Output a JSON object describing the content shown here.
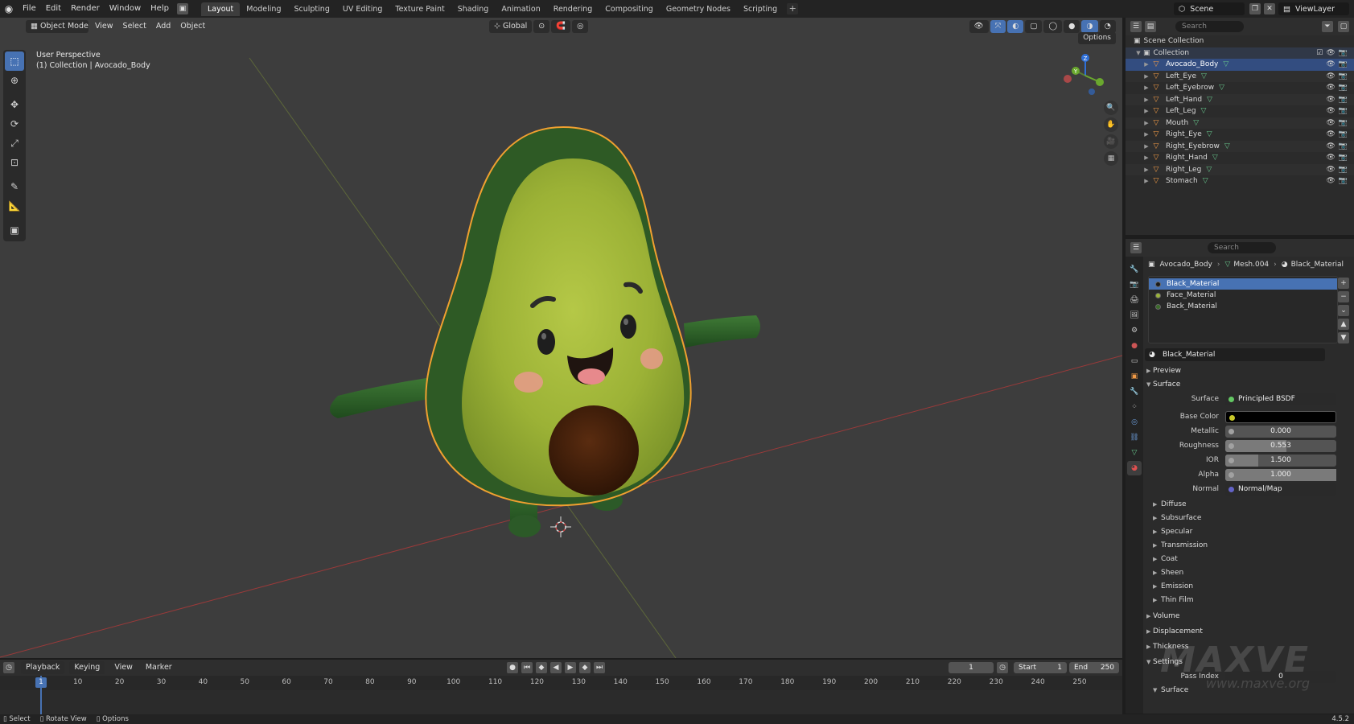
{
  "topbar": {
    "menus": [
      "File",
      "Edit",
      "Render",
      "Window",
      "Help"
    ],
    "workspaces": [
      "Layout",
      "Modeling",
      "Sculpting",
      "UV Editing",
      "Texture Paint",
      "Shading",
      "Animation",
      "Rendering",
      "Compositing",
      "Geometry Nodes",
      "Scripting"
    ],
    "active_workspace": "Layout",
    "scene": "Scene",
    "view_layer": "ViewLayer"
  },
  "viewport": {
    "mode": "Object Mode",
    "menus": [
      "View",
      "Select",
      "Add",
      "Object"
    ],
    "transform_orientation": "Global",
    "options_label": "Options",
    "perspective_label": "User Perspective",
    "collection_label": "(1) Collection | Avocado_Body"
  },
  "outliner": {
    "search_placeholder": "Search",
    "root": "Scene Collection",
    "collection": "Collection",
    "objects": [
      "Avocado_Body",
      "Left_Eye",
      "Left_Eyebrow",
      "Left_Hand",
      "Left_Leg",
      "Mouth",
      "Right_Eye",
      "Right_Eyebrow",
      "Right_Hand",
      "Right_Leg",
      "Stomach"
    ],
    "selected": "Avocado_Body"
  },
  "properties": {
    "search_placeholder": "Search",
    "breadcrumb": [
      "Avocado_Body",
      "Mesh.004",
      "Black_Material"
    ],
    "slots": [
      {
        "name": "Black_Material",
        "color": "#1a1a1a"
      },
      {
        "name": "Face_Material",
        "color": "#9bb33a"
      },
      {
        "name": "Back_Material",
        "color": "#3b6b2a"
      }
    ],
    "active_material": "Black_Material",
    "panels": {
      "preview": "Preview",
      "surface": "Surface"
    },
    "surface_shader_label": "Surface",
    "surface_shader": "Principled BSDF",
    "fields": [
      {
        "label": "Base Color",
        "value": "",
        "type": "color"
      },
      {
        "label": "Metallic",
        "value": "0.000",
        "fill": 0.0
      },
      {
        "label": "Roughness",
        "value": "0.553",
        "fill": 0.553
      },
      {
        "label": "IOR",
        "value": "1.500",
        "fill": 0.3
      },
      {
        "label": "Alpha",
        "value": "1.000",
        "fill": 1.0
      }
    ],
    "normal_label": "Normal",
    "normal_value": "Normal/Map",
    "sub_panels": [
      "Diffuse",
      "Subsurface",
      "Specular",
      "Transmission",
      "Coat",
      "Sheen",
      "Emission",
      "Thin Film"
    ],
    "bottom_panels": [
      "Volume",
      "Displacement",
      "Thickness",
      "Settings"
    ],
    "pass_index_label": "Pass Index",
    "pass_index_value": "0",
    "settings_surface": "Surface"
  },
  "timeline": {
    "menus": [
      "Playback",
      "Keying",
      "View",
      "Marker"
    ],
    "current_frame": "1",
    "start_label": "Start",
    "start_value": "1",
    "end_label": "End",
    "end_value": "250",
    "ticks": [
      "1",
      "10",
      "20",
      "30",
      "40",
      "50",
      "60",
      "70",
      "80",
      "90",
      "100",
      "110",
      "120",
      "130",
      "140",
      "150",
      "160",
      "170",
      "180",
      "190",
      "200",
      "210",
      "220",
      "230",
      "240",
      "250"
    ]
  },
  "statusbar": {
    "items": [
      "Select",
      "Rotate View",
      "Options"
    ],
    "version": "4.5.2"
  },
  "watermark": {
    "title": "MAXVE",
    "url": "www.maxve.org"
  }
}
